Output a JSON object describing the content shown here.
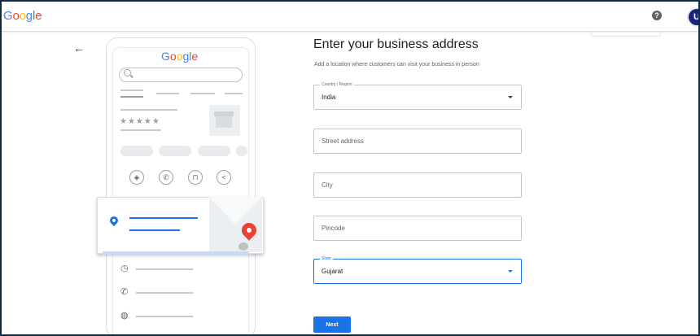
{
  "header": {
    "logo_letters": [
      {
        "char": "G",
        "color": "#4285f4"
      },
      {
        "char": "o",
        "color": "#ea4335"
      },
      {
        "char": "o",
        "color": "#fbbc05"
      },
      {
        "char": "g",
        "color": "#4285f4"
      },
      {
        "char": "l",
        "color": "#34a853"
      },
      {
        "char": "e",
        "color": "#ea4335"
      }
    ],
    "help_icon": "help-circle-icon",
    "help_glyph": "?",
    "avatar_initial": "U",
    "avatar_color": "#1a237e"
  },
  "nav": {
    "back_icon": "arrow-left-icon",
    "back_glyph": "←"
  },
  "illustration": {
    "logo_letters": [
      {
        "char": "G",
        "color": "#4285f4"
      },
      {
        "char": "o",
        "color": "#ea4335"
      },
      {
        "char": "o",
        "color": "#fbbc05"
      },
      {
        "char": "g",
        "color": "#4285f4"
      },
      {
        "char": "l",
        "color": "#34a853"
      },
      {
        "char": "e",
        "color": "#ea4335"
      }
    ],
    "stars": "★★★★★",
    "action_icons": [
      "directions-icon",
      "phone-icon",
      "bookmark-icon",
      "share-icon"
    ],
    "action_glyphs": [
      "◈",
      "✆",
      "⊓",
      "<"
    ],
    "row_icons": [
      "clock-icon",
      "phone-icon",
      "globe-icon"
    ],
    "row_glyphs": [
      "◷",
      "✆",
      "◍"
    ]
  },
  "form": {
    "title": "Enter your business address",
    "subtitle": "Add a location where customers can visit your business in person",
    "country": {
      "label": "Country / Region",
      "value": "India"
    },
    "street": {
      "placeholder": "Street address",
      "value": ""
    },
    "city": {
      "placeholder": "City",
      "value": ""
    },
    "pincode": {
      "placeholder": "Pincode",
      "value": ""
    },
    "state": {
      "label": "State",
      "value": "Gujarat"
    },
    "next_label": "Next",
    "accent": "#1a73e8"
  }
}
